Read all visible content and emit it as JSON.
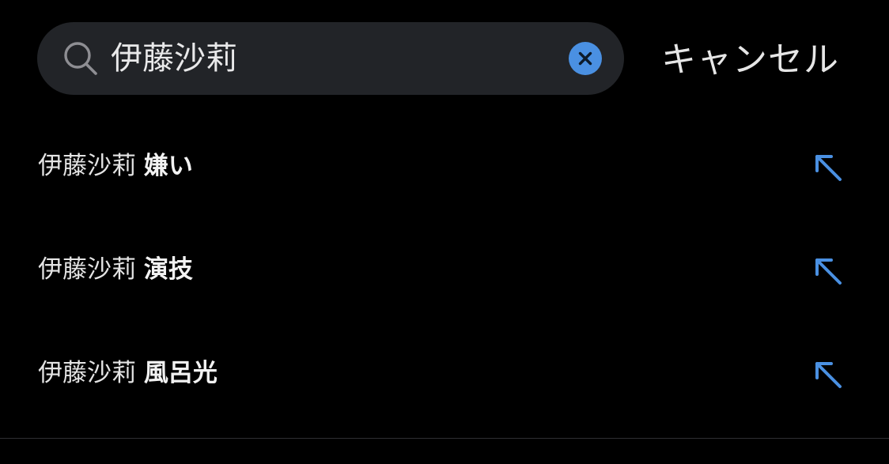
{
  "search": {
    "value": "伊藤沙莉",
    "placeholder": "",
    "cancel_label": "キャンセル"
  },
  "suggestions": [
    {
      "query": "伊藤沙莉",
      "completion": "嫌い"
    },
    {
      "query": "伊藤沙莉",
      "completion": "演技"
    },
    {
      "query": "伊藤沙莉",
      "completion": "風呂光"
    }
  ],
  "icons": {
    "search": "search-icon",
    "clear": "clear-icon",
    "fill_suggestion": "arrow-up-left-icon"
  },
  "colors": {
    "background": "#000000",
    "search_field": "#222428",
    "accent": "#4a90e2",
    "text": "#e6e6e6"
  }
}
